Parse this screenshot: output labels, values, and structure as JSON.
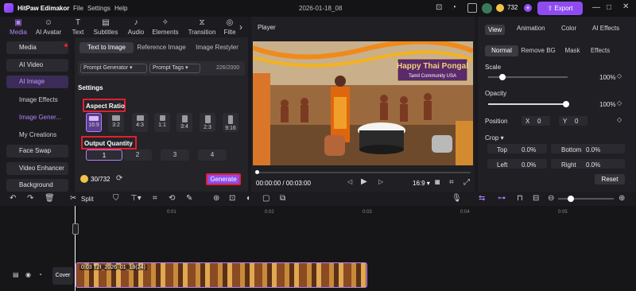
{
  "app": {
    "name": "HitPaw Edimakor",
    "menu": [
      "File",
      "Settings",
      "Help"
    ],
    "doc_title": "2026-01-18_08",
    "coins": "732",
    "export_label": "Export"
  },
  "toolbar": {
    "items": [
      {
        "label": "Media",
        "icon": "media-icon",
        "active": true
      },
      {
        "label": "AI Avatar",
        "icon": "avatar-icon"
      },
      {
        "label": "Text",
        "icon": "text-icon"
      },
      {
        "label": "Subtitles",
        "icon": "subtitles-icon"
      },
      {
        "label": "Audio",
        "icon": "audio-icon"
      },
      {
        "label": "Elements",
        "icon": "elements-icon"
      },
      {
        "label": "Transition",
        "icon": "transition-icon"
      },
      {
        "label": "Filte",
        "icon": "filter-icon"
      }
    ]
  },
  "leftnav": {
    "media": "Media",
    "ai_video": "AI Video",
    "ai_image": "AI Image",
    "image_effects": "Image Effects",
    "image_gen": "Image Gener...",
    "my_creations": "My Creations",
    "face_swap": "Face Swap",
    "video_enhancer": "Video Enhancer",
    "background": "Background"
  },
  "panel": {
    "tabs": [
      "Text to Image",
      "Reference Image",
      "Image Restyler"
    ],
    "prompt_generator": "Prompt Generator",
    "prompt_tags": "Prompt Tags",
    "counter": "226/2000",
    "settings": "Settings",
    "aspect_ratio": "Aspect Ratio",
    "ratios": [
      "16:9",
      "3:2",
      "4:3",
      "1:1",
      "3:4",
      "2:3",
      "9:16"
    ],
    "output_quantity": "Output Quantity",
    "quantities": [
      "1",
      "2",
      "3",
      "4"
    ],
    "credits": "30/732",
    "generate": "Generate"
  },
  "player": {
    "title": "Player",
    "time": "00:00:00 / 00:03:00",
    "ratio": "16:9",
    "banner_line1": "Happy Thai Pongal",
    "banner_line2": "Tamil Community USA"
  },
  "right": {
    "tabs": [
      "View",
      "Animation",
      "Color",
      "AI Effects"
    ],
    "segments": [
      "Normal",
      "Remove BG",
      "Mask",
      "Effects"
    ],
    "scale": "Scale",
    "scale_val": "100%",
    "opacity": "Opacity",
    "opacity_val": "100%",
    "position": "Position",
    "x_label": "X",
    "x_val": "0",
    "y_label": "Y",
    "y_val": "0",
    "crop": "Crop",
    "top": "Top",
    "top_val": "0.0%",
    "bottom": "Bottom",
    "bottom_val": "0.0%",
    "left": "Left",
    "left_val": "0.0%",
    "right_label": "Right",
    "right_val": "0.0%",
    "reset": "Reset"
  },
  "timeline": {
    "split": "Split",
    "ticks": [
      "0:01",
      "0:02",
      "0:03",
      "0:04",
      "0:05"
    ],
    "clip_label": "0:03 T2I_2026_01_18(24)",
    "cover": "Cover"
  },
  "colors": {
    "accent": "#8e4cf0",
    "highlight": "#e02030"
  }
}
